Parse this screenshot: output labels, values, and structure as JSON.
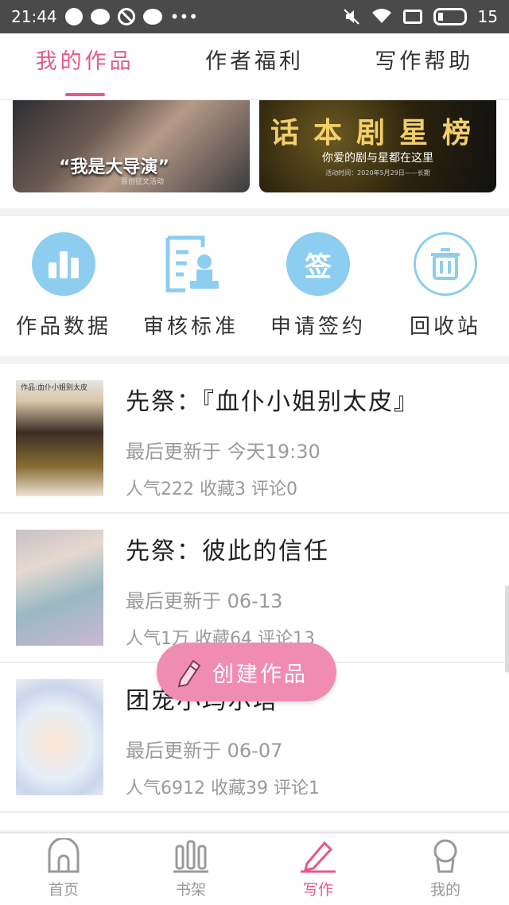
{
  "status_bar": {
    "time": "21:44",
    "battery": "15"
  },
  "top_tabs": [
    {
      "label": "我的作品",
      "active": true
    },
    {
      "label": "作者福利",
      "active": false
    },
    {
      "label": "写作帮助",
      "active": false
    }
  ],
  "banners": {
    "left": {
      "caption": "“我是大导演”",
      "sub": "原创征文活动"
    },
    "right": {
      "caption": "话本剧星榜",
      "sub": "你爱的剧与星都在这里",
      "sub2": "活动时间：2020年5月29日——长期"
    }
  },
  "features": [
    {
      "label": "作品数据",
      "icon": "bar-chart-icon"
    },
    {
      "label": "审核标准",
      "icon": "document-stamp-icon"
    },
    {
      "label": "申请签约",
      "icon": "sign-icon",
      "glyph": "签"
    },
    {
      "label": "回收站",
      "icon": "trash-icon"
    }
  ],
  "works": [
    {
      "title": "先祭：『血仆小姐别太皮』",
      "updated": "最后更新于 今天19:30",
      "stats": "人气222 收藏3 评论0",
      "cover_text": "作品:血仆小姐别太皮"
    },
    {
      "title": "先祭：彼此的信任",
      "updated": "最后更新于 06-13",
      "stats": "人气1万 收藏64 评论13",
      "cover_text": ""
    },
    {
      "title": "团宠小玛尔塔",
      "updated": "最后更新于 06-07",
      "stats": "人气6912 收藏39 评论1",
      "cover_text": ""
    }
  ],
  "fab": {
    "label": "创建作品"
  },
  "bottom_nav": [
    {
      "label": "首页",
      "icon": "home-icon",
      "active": false
    },
    {
      "label": "书架",
      "icon": "bookshelf-icon",
      "active": false
    },
    {
      "label": "写作",
      "icon": "pen-icon",
      "active": true
    },
    {
      "label": "我的",
      "icon": "profile-icon",
      "active": false
    }
  ],
  "colors": {
    "accent": "#e8578a",
    "icon_blue": "#8ccdf0",
    "fab": "#f08cb2"
  }
}
